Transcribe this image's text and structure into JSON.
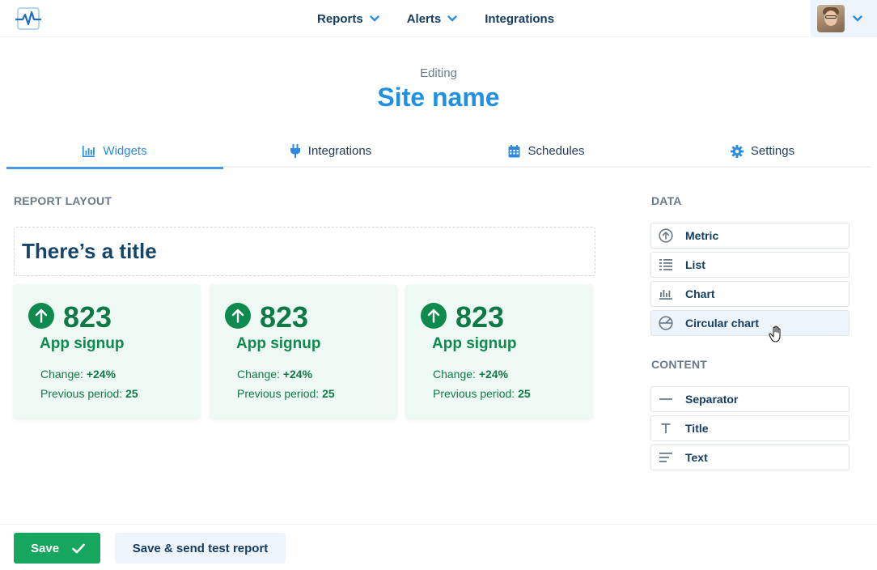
{
  "nav": {
    "items": [
      {
        "label": "Reports",
        "has_dropdown": true
      },
      {
        "label": "Alerts",
        "has_dropdown": true
      },
      {
        "label": "Integrations",
        "has_dropdown": false
      }
    ],
    "logo_icon": "pulse-logo-icon",
    "user_menu_icon": "chevron-down-icon"
  },
  "header": {
    "subtitle": "Editing",
    "title": "Site name"
  },
  "tabs": [
    {
      "label": "Widgets",
      "icon": "bar-chart-icon",
      "active": true
    },
    {
      "label": "Integrations",
      "icon": "plug-icon",
      "active": false
    },
    {
      "label": "Schedules",
      "icon": "calendar-icon",
      "active": false
    },
    {
      "label": "Settings",
      "icon": "gear-icon",
      "active": false
    }
  ],
  "report_layout": {
    "label": "REPORT LAYOUT",
    "title_widget": "There’s a title",
    "cards": [
      {
        "value": "823",
        "name": "App signup",
        "change_label": "Change:",
        "change_value": "+24%",
        "prev_label": "Previous period:",
        "prev_value": "25"
      },
      {
        "value": "823",
        "name": "App signup",
        "change_label": "Change:",
        "change_value": "+24%",
        "prev_label": "Previous period:",
        "prev_value": "25"
      },
      {
        "value": "823",
        "name": "App signup",
        "change_label": "Change:",
        "change_value": "+24%",
        "prev_label": "Previous period:",
        "prev_value": "25"
      }
    ]
  },
  "data_panel": {
    "label": "DATA",
    "items": [
      {
        "label": "Metric",
        "icon": "arrow-up-circle-icon"
      },
      {
        "label": "List",
        "icon": "list-icon"
      },
      {
        "label": "Chart",
        "icon": "bar-chart-icon"
      },
      {
        "label": "Circular chart",
        "icon": "pie-chart-icon"
      }
    ]
  },
  "content_panel": {
    "label": "CONTENT",
    "items": [
      {
        "label": "Separator",
        "icon": "separator-icon"
      },
      {
        "label": "Title",
        "icon": "title-t-icon"
      },
      {
        "label": "Text",
        "icon": "text-lines-icon"
      }
    ]
  },
  "footer": {
    "save_label": "Save",
    "test_label": "Save & send test report"
  },
  "colors": {
    "accent": "#1e90e6",
    "nav_text": "#143d63",
    "success": "#17a660",
    "card_bg": "#eef9f3",
    "card_text": "#0f7a46"
  }
}
